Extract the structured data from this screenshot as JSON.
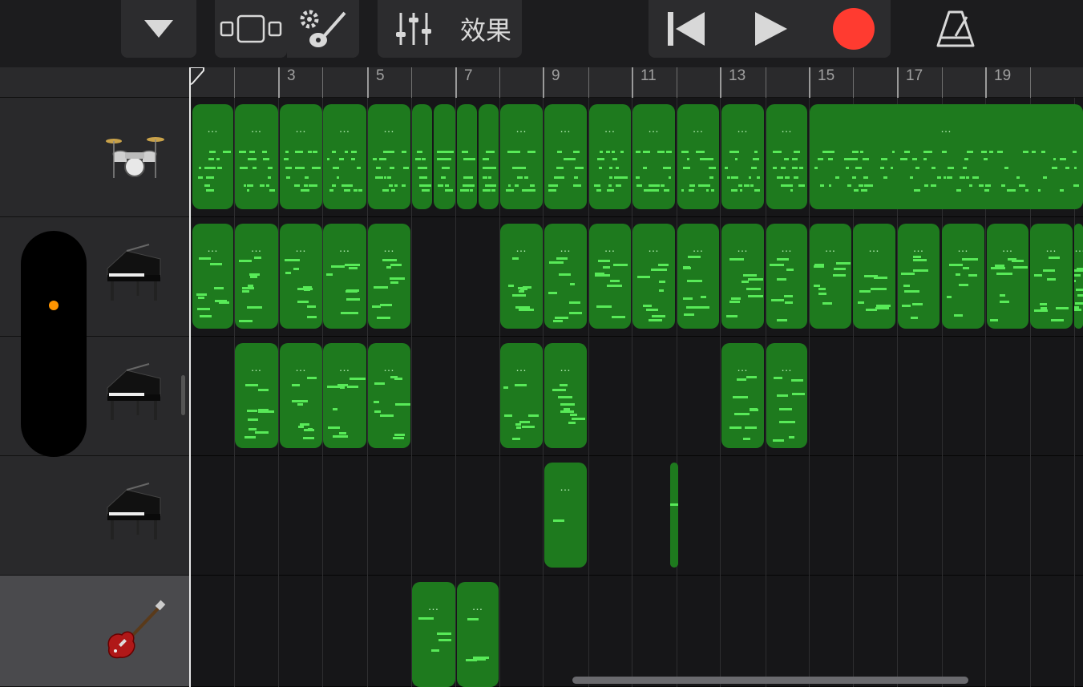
{
  "toolbar": {
    "tracks_dropdown_icon": "triangle-down-icon",
    "view_icon": "tracks-view-icon",
    "settings_icon": "instrument-settings-icon",
    "mixer_icon": "mixer-sliders-icon",
    "fx_label": "效果",
    "rewind_icon": "skip-to-start-icon",
    "play_icon": "play-icon",
    "record_icon": "record-icon",
    "metronome_icon": "metronome-icon",
    "record_color": "#ff3b30"
  },
  "ruler": {
    "bar_numbers": [
      "3",
      "5",
      "7",
      "9",
      "11",
      "13",
      "15",
      "17",
      "19"
    ]
  },
  "tracks": [
    {
      "instrument": "drum-kit",
      "icon": "drum-kit-icon"
    },
    {
      "instrument": "grand-piano",
      "icon": "grand-piano-icon"
    },
    {
      "instrument": "grand-piano",
      "icon": "grand-piano-icon"
    },
    {
      "instrument": "grand-piano",
      "icon": "grand-piano-icon"
    },
    {
      "instrument": "electric-guitar",
      "icon": "electric-guitar-icon",
      "selected": true
    }
  ],
  "region_menu_glyph": "…",
  "colors": {
    "region": "#1e7a1e",
    "note": "#58ea58",
    "volume_dot": "#ff9500"
  }
}
